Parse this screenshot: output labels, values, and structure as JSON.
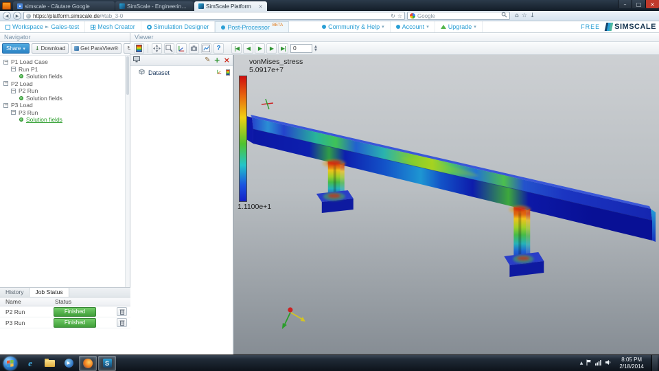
{
  "browser": {
    "tabs": [
      {
        "label": "simscale - Căutare Google"
      },
      {
        "label": "SimScale - Engineering simulation in ..."
      },
      {
        "label": "SimScale Platform"
      }
    ],
    "nav": {
      "url_domain": "https://platform.simscale.de",
      "url_path": "/#tab_3-0",
      "search_value": "Google"
    }
  },
  "appbar": {
    "workspace_label": "Workspace",
    "workspace_name": "Gales-test",
    "mesh_creator": "Mesh Creator",
    "sim_designer": "Simulation Designer",
    "post_processor": "Post-Processor",
    "beta": "BETA",
    "community": "Community & Help",
    "account": "Account",
    "upgrade": "Upgrade",
    "plan": "FREE",
    "brand": "SIMSCALE"
  },
  "navigator": {
    "title": "Navigator",
    "share": "Share",
    "download": "Download",
    "paraview": "Get ParaView®",
    "tree": [
      {
        "label": "P1 Load Case"
      },
      {
        "label": "Run P1"
      },
      {
        "label": "Solution fields"
      },
      {
        "label": "P2 Load"
      },
      {
        "label": "P2 Run"
      },
      {
        "label": "Solution fields"
      },
      {
        "label": "P3 Load"
      },
      {
        "label": "P3 Run"
      },
      {
        "label": "Solution fields"
      }
    ]
  },
  "jobs": {
    "tab_history": "History",
    "tab_job_status": "Job Status",
    "col_name": "Name",
    "col_status": "Status",
    "rows": [
      {
        "name": "P2 Run",
        "status": "Finished"
      },
      {
        "name": "P3 Run",
        "status": "Finished"
      }
    ]
  },
  "viewer": {
    "title": "Viewer",
    "frame": "0",
    "dataset": "Dataset",
    "legend_title": "vonMises_stress",
    "legend_max": "5.0917e+7",
    "legend_min": "1.1100e+1"
  },
  "taskbar": {
    "time": "8:05 PM",
    "date": "2/18/2014"
  },
  "glyphs": {
    "back": "◀",
    "forward": "▶",
    "reload": "↻",
    "star": "☆",
    "home": "⌂",
    "win_min": "–",
    "win_max": "□",
    "win_close": "×",
    "dropdown": "▾",
    "workspace_arrow": "►",
    "download_arrow": "↓",
    "refresh": "↻",
    "toggle_minus": "−",
    "pencil": "✎",
    "plus": "+",
    "close_x": "×",
    "help": "?",
    "play_first": "|◀",
    "play_prev": "◀",
    "play": "▶",
    "play_next": "▶",
    "play_last": "▶|",
    "spin_up": "▲",
    "spin_down": "▼",
    "tray_up": "▲",
    "ie": "e",
    "app_s": "S",
    "media_play": "▶"
  },
  "colors": {
    "accent_teal": "#2a9fd5",
    "finished_green": "#3f9e38",
    "share_blue": "#2b82c4",
    "beam_blue": "#0d1fae",
    "colorbar_top_red": "#cf0d0d",
    "colorbar_bottom_blue": "#1420c8"
  }
}
